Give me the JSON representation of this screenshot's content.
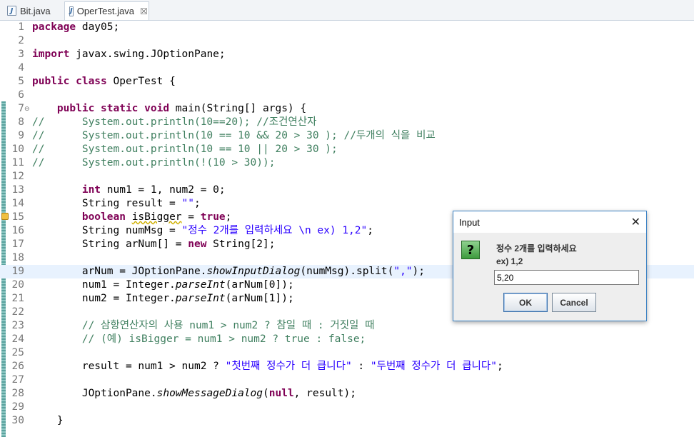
{
  "tabs": [
    {
      "label": "Bit.java",
      "active": false
    },
    {
      "label": "OperTest.java",
      "active": true,
      "close": "☒"
    }
  ],
  "editor": {
    "lines": [
      {
        "n": "1",
        "html": "<span class='kw'>package</span> day05;"
      },
      {
        "n": "2",
        "html": ""
      },
      {
        "n": "3",
        "html": "<span class='kw'>import</span> javax.swing.JOptionPane;"
      },
      {
        "n": "4",
        "html": ""
      },
      {
        "n": "5",
        "html": "<span class='kw'>public class</span> OperTest {"
      },
      {
        "n": "6",
        "html": ""
      },
      {
        "n": "7",
        "html": "    <span class='kw'>public static void</span> main(String[] args) {",
        "fold": true
      },
      {
        "n": "8",
        "html": "<span class='cm'>//      System.out.println(10==20); //조건연산자</span>"
      },
      {
        "n": "9",
        "html": "<span class='cm'>//      System.out.println(10 == 10 &amp;&amp; 20 &gt; 30 ); //두개의 식을 비교</span>"
      },
      {
        "n": "10",
        "html": "<span class='cm'>//      System.out.println(10 == 10 || 20 &gt; 30 );</span>"
      },
      {
        "n": "11",
        "html": "<span class='cm'>//      System.out.println(!(10 &gt; 30));</span>"
      },
      {
        "n": "12",
        "html": ""
      },
      {
        "n": "13",
        "html": "        <span class='kw'>int</span> num1 = 1, num2 = 0;"
      },
      {
        "n": "14",
        "html": "        String result = <span class='str'>\"\"</span>;"
      },
      {
        "n": "15",
        "html": "        <span class='kw'>boolean</span> <span class='under'>isBigger</span> = <span class='kw'>true</span>;",
        "warn": true
      },
      {
        "n": "16",
        "html": "        String numMsg = <span class='str'>\"정수 2개를 입력하세요 \\n ex) 1,2\"</span>;"
      },
      {
        "n": "17",
        "html": "        String arNum[] = <span class='kw'>new</span> String[2];"
      },
      {
        "n": "18",
        "html": ""
      },
      {
        "n": "19",
        "html": "        arNum = JOptionPane.<span class='it'>showInputDialog</span>(numMsg).split(<span class='str'>\",\"</span>);",
        "current": true
      },
      {
        "n": "20",
        "html": "        num1 = Integer.<span class='it'>parseInt</span>(arNum[0]);"
      },
      {
        "n": "21",
        "html": "        num2 = Integer.<span class='it'>parseInt</span>(arNum[1]);"
      },
      {
        "n": "22",
        "html": ""
      },
      {
        "n": "23",
        "html": "        <span class='cm'>// 삼항연산자의 사용 num1 &gt; num2 ? 참일 때 : 거짓일 때</span>"
      },
      {
        "n": "24",
        "html": "        <span class='cm'>// (예) isBigger = num1 &gt; num2 ? true : false;</span>"
      },
      {
        "n": "25",
        "html": ""
      },
      {
        "n": "26",
        "html": "        result = num1 &gt; num2 ? <span class='str'>\"첫번째 정수가 더 큽니다\"</span> : <span class='str'>\"두번째 정수가 더 큽니다\"</span>;"
      },
      {
        "n": "27",
        "html": ""
      },
      {
        "n": "28",
        "html": "        JOptionPane.<span class='it'>showMessageDialog</span>(<span class='kw'>null</span>, result);"
      },
      {
        "n": "29",
        "html": ""
      },
      {
        "n": "30",
        "html": "    }"
      }
    ]
  },
  "dialog": {
    "title": "Input",
    "close": "✕",
    "icon": "?",
    "message_line1": "정수 2개를 입력하세요",
    "message_line2": "ex) 1,2",
    "input_value": "5,20",
    "ok_label": "OK",
    "cancel_label": "Cancel"
  }
}
